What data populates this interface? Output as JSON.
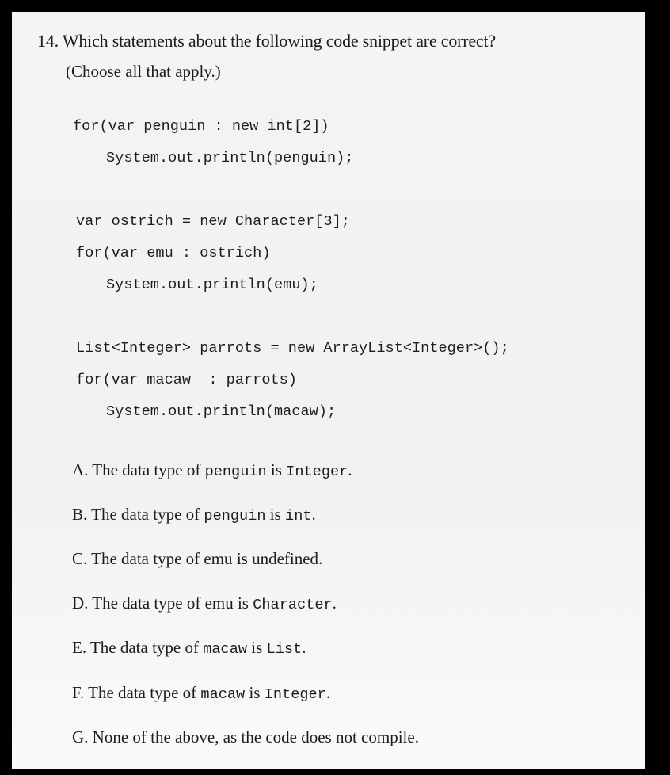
{
  "question": {
    "title": "14. Which statements about the following code snippet are correct?",
    "subtitle": "(Choose all that apply.)"
  },
  "code": {
    "block1": {
      "line1": "for(var penguin : new int[2])",
      "line2": "System.out.println(penguin);"
    },
    "block2": {
      "line1": "var ostrich = new Character[3];",
      "line2": "for(var emu : ostrich)",
      "line3": "System.out.println(emu);"
    },
    "block3": {
      "line1": "List<Integer> parrots = new ArrayList<Integer>();",
      "line2": "for(var macaw  : parrots)",
      "line3": "System.out.println(macaw);"
    }
  },
  "options": {
    "a": {
      "pre": "A. The data type of ",
      "var": "penguin",
      "mid": " is ",
      "type": "Integer",
      "post": "."
    },
    "b": {
      "pre": "B. The data type of ",
      "var": "penguin",
      "mid": " is ",
      "type": "int",
      "post": "."
    },
    "c": {
      "pre": "C. The data type of ",
      "var": "emu",
      "mid": " is undefined.",
      "type": "",
      "post": ""
    },
    "d": {
      "pre": "D. The data type of ",
      "var": "emu",
      "mid": " is ",
      "type": "Character",
      "post": "."
    },
    "e": {
      "pre": "E. The data type of ",
      "var": "macaw",
      "mid": " is ",
      "type": "List",
      "post": "."
    },
    "f": {
      "pre": "F. The data type of ",
      "var": "macaw",
      "mid": " is ",
      "type": "Integer",
      "post": "."
    },
    "g": {
      "pre": "G. None of the above, as the code does not compile.",
      "var": "",
      "mid": "",
      "type": "",
      "post": ""
    }
  }
}
